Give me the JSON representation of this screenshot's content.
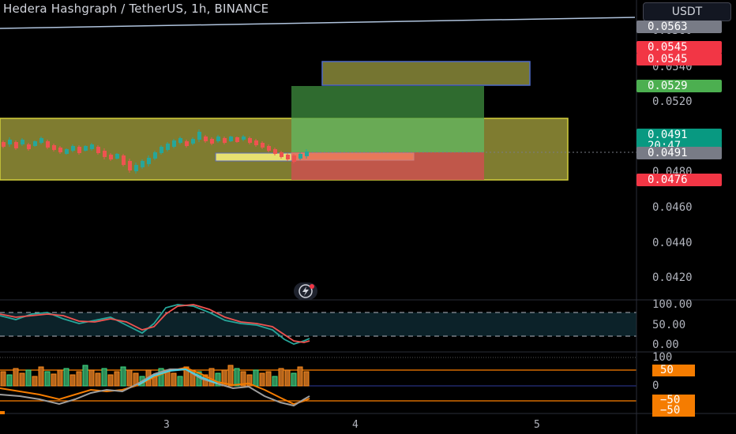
{
  "header": {
    "title": "Hedera Hashgraph / TetherUS, 1h, BINANCE",
    "currency_button": "USDT"
  },
  "price_axis": {
    "labels": [
      "0.0560",
      "0.0540",
      "0.0520",
      "0.0480",
      "0.0460",
      "0.0440",
      "0.0420"
    ]
  },
  "price_tags": {
    "top_line": "0.0563",
    "target_1": "0.0545",
    "target_2": "0.0545",
    "take_profit": "0.0529",
    "last_price": "0.0491",
    "countdown": "20:47",
    "last_price_2": "0.0491",
    "stop": "0.0476"
  },
  "oscillator_1": {
    "labels": [
      "100.00",
      "50.00",
      "0.00"
    ]
  },
  "oscillator_2": {
    "labels": [
      "100",
      "0"
    ],
    "tag_pos": "50",
    "tag_neg_1": "−50",
    "tag_neg_2": "−50"
  },
  "time_axis": {
    "labels": [
      "3",
      "4",
      "5"
    ]
  },
  "colors": {
    "background": "#000000",
    "up": "#26a69a",
    "down": "#ef5350",
    "zone": "#8a8a2a",
    "long_green": "#2e7d32",
    "short_red": "#c62828",
    "tag_green": "#4caf50",
    "tag_red": "#f23645",
    "tag_teal": "#089981",
    "tag_grey": "#787b86",
    "tag_orange": "#f57c00"
  },
  "icons": {
    "lightning": "lightning-icon"
  }
}
